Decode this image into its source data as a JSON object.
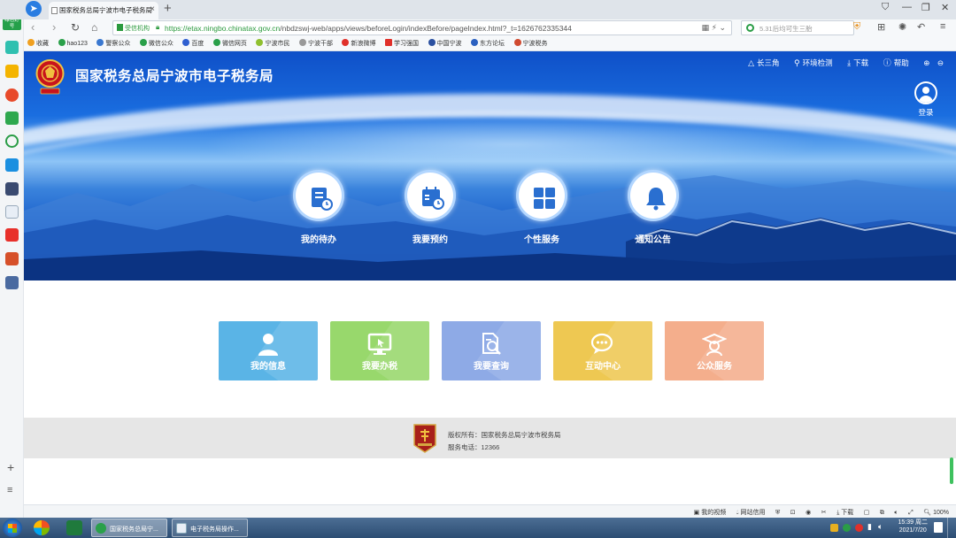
{
  "browser": {
    "sidebar_label": "绿色好号",
    "tab_title": "国家税务总局宁波市电子税务局",
    "url_label": "受信机构",
    "url_host": "https://etax.ningbo.chinatax.gov.cn",
    "url_path": "/nbdzswj-web/apps/views/beforeLogin/indexBefore/pageIndex.html?_t=1626762335344",
    "search_placeholder": "5.31后均可生三胎",
    "bookmarks": [
      {
        "label": "收藏",
        "color": "#f0a020"
      },
      {
        "label": "hao123",
        "color": "#2aa04a"
      },
      {
        "label": "警察公众",
        "color": "#3a78d0"
      },
      {
        "label": "微信公众",
        "color": "#2aa04a"
      },
      {
        "label": "百度",
        "color": "#2f5fd0"
      },
      {
        "label": "微信网页",
        "color": "#2aa04a"
      },
      {
        "label": "宁波市民",
        "color": "#90c030"
      },
      {
        "label": "宁波干部",
        "color": "#999999"
      },
      {
        "label": "新浪微博",
        "color": "#e0302a"
      },
      {
        "label": "学习强国",
        "color": "#e0302a"
      },
      {
        "label": "中国宁波",
        "color": "#2a50a0"
      },
      {
        "label": "东方论坛",
        "color": "#2a60c0"
      },
      {
        "label": "宁波税务",
        "color": "#d04a30"
      }
    ]
  },
  "header": {
    "title": "国家税务总局宁波市电子税务局",
    "nav": [
      {
        "label": "长三角",
        "icon": "triangle-icon"
      },
      {
        "label": "环境检测",
        "icon": "network-icon"
      },
      {
        "label": "下载",
        "icon": "download-icon"
      },
      {
        "label": "帮助",
        "icon": "help-icon"
      }
    ],
    "login_label": "登录"
  },
  "quick_actions": [
    {
      "label": "我的待办",
      "icon": "todo-document-icon"
    },
    {
      "label": "我要预约",
      "icon": "calendar-clock-icon"
    },
    {
      "label": "个性服务",
      "icon": "grid-apps-icon"
    },
    {
      "label": "通知公告",
      "icon": "bell-icon"
    }
  ],
  "tiles": [
    {
      "label": "我的信息",
      "color": "#5ab4e6",
      "icon": "user-icon"
    },
    {
      "label": "我要办税",
      "color": "#98d86c",
      "icon": "monitor-cursor-icon"
    },
    {
      "label": "我要查询",
      "color": "#8eaae6",
      "icon": "document-search-icon"
    },
    {
      "label": "互动中心",
      "color": "#eec852",
      "icon": "chat-bubble-icon"
    },
    {
      "label": "公众服务",
      "color": "#f4ae8c",
      "icon": "graduate-icon"
    }
  ],
  "footer": {
    "copyright": "版权所有：国家税务总局宁波市税务局",
    "phone": "服务电话：12366"
  },
  "statusbar": [
    "我的视频",
    "网站信用",
    "下载",
    "100%"
  ],
  "taskbar": {
    "tasks": [
      "国家税务总局宁...",
      "电子税务局操作..."
    ],
    "time": "15:39 周二",
    "date": "2021/7/20"
  },
  "colors": {
    "brand_blue": "#1a66dc",
    "footer_bg": "#e6e6e6"
  }
}
